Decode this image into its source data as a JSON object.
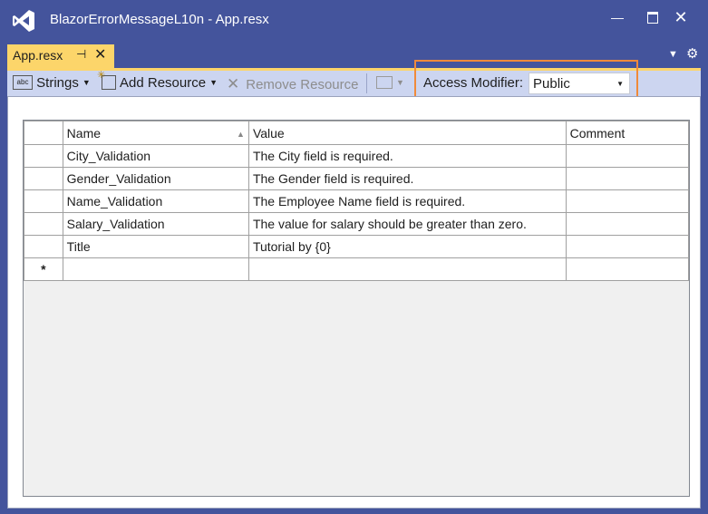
{
  "window": {
    "title": "BlazorErrorMessageL10n - App.resx",
    "logo_icon": "visual-studio-logo",
    "controls": [
      "minimize-icon",
      "maximize-icon",
      "close-icon"
    ]
  },
  "tabs": [
    {
      "label": "App.resx",
      "pin_icon": "pin-icon",
      "close_icon": "close-icon"
    }
  ],
  "toolbar": {
    "strings_label": "Strings",
    "add_resource_label": "Add Resource",
    "remove_resource_label": "Remove Resource",
    "access_modifier_label": "Access Modifier:",
    "access_modifier_value": "Public"
  },
  "grid": {
    "columns": [
      "Name",
      "Value",
      "Comment"
    ],
    "rows": [
      {
        "name": "City_Validation",
        "value": "The City field is required.",
        "comment": ""
      },
      {
        "name": "Gender_Validation",
        "value": "The Gender field is required.",
        "comment": ""
      },
      {
        "name": "Name_Validation",
        "value": "The Employee Name field is required.",
        "comment": ""
      },
      {
        "name": "Salary_Validation",
        "value": "The value for salary should be greater than zero.",
        "comment": ""
      },
      {
        "name": "Title",
        "value": "Tutorial by {0}",
        "comment": ""
      }
    ],
    "new_row_marker": "*"
  },
  "colors": {
    "chrome": "#44549c",
    "active_tab": "#fcd56a",
    "toolbar": "#ccd5f0",
    "highlight": "#f08a3a"
  }
}
